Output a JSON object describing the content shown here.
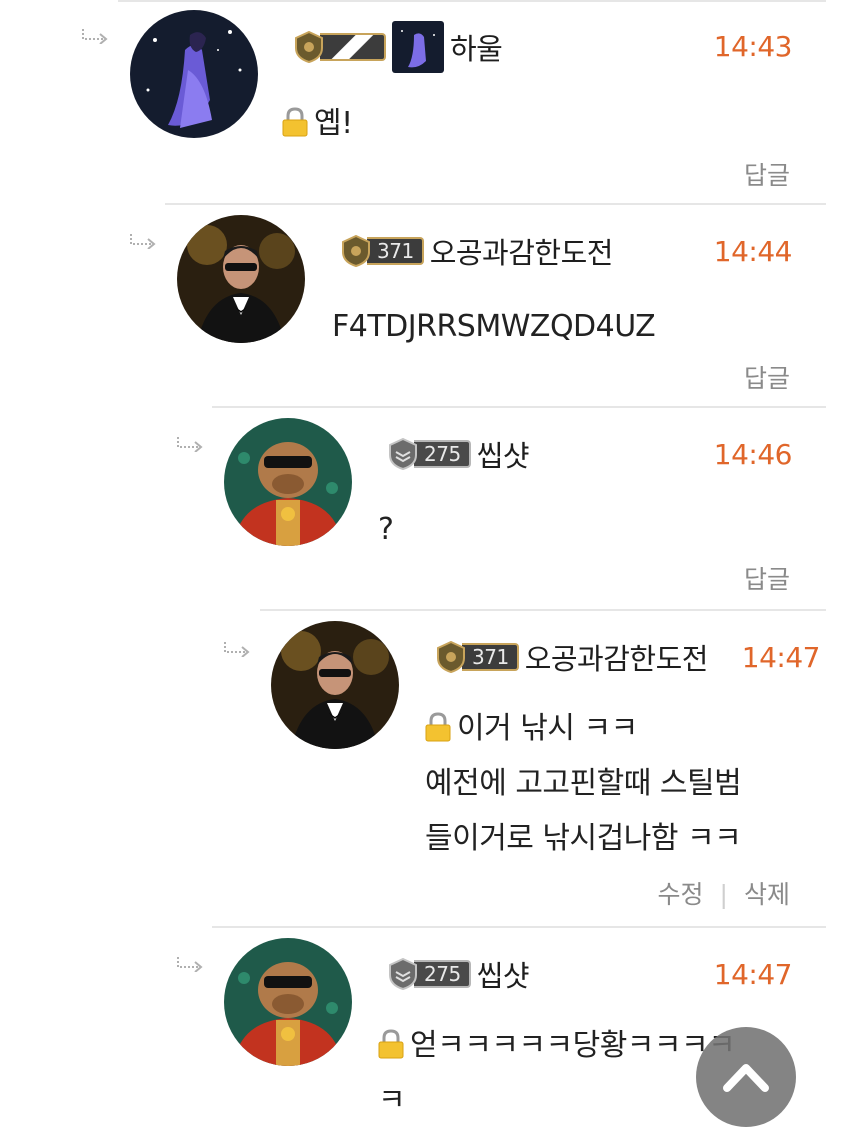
{
  "comments": [
    {
      "nickname": "하울",
      "time": "14:43",
      "lines": [
        "옙!"
      ],
      "locked": true,
      "level": "",
      "actions": [
        "답글"
      ]
    },
    {
      "nickname": "오공과감한도전",
      "time": "14:44",
      "lines": [
        "F4TDJRRSMWZQD4UZ"
      ],
      "locked": false,
      "level": "371",
      "actions": [
        "답글"
      ]
    },
    {
      "nickname": "씹샷",
      "time": "14:46",
      "lines": [
        "?"
      ],
      "locked": false,
      "level": "275",
      "actions": [
        "답글"
      ]
    },
    {
      "nickname": "오공과감한도전",
      "time": "14:47",
      "lines": [
        "이거 낚시 ㅋㅋ",
        "예전에 고고핀할때 스틸범",
        "들이거로 낚시겁나함 ㅋㅋ"
      ],
      "locked": true,
      "level": "371",
      "actions": [
        "수정",
        "삭제"
      ]
    },
    {
      "nickname": "씹샷",
      "time": "14:47",
      "lines": [
        "얻ㅋㅋㅋㅋㅋ당황ㅋㅋㅋㅋ",
        "ㅋ"
      ],
      "locked": true,
      "level": "275",
      "actions": []
    }
  ],
  "colors": {
    "time": "#e0662a",
    "badge_gold": "#c8a45b",
    "divider": "#e6e6e6"
  },
  "icons": {
    "reply_arrow": "reply-arrow-icon",
    "lock": "lock-icon",
    "scroll_top": "chevron-up-icon"
  }
}
